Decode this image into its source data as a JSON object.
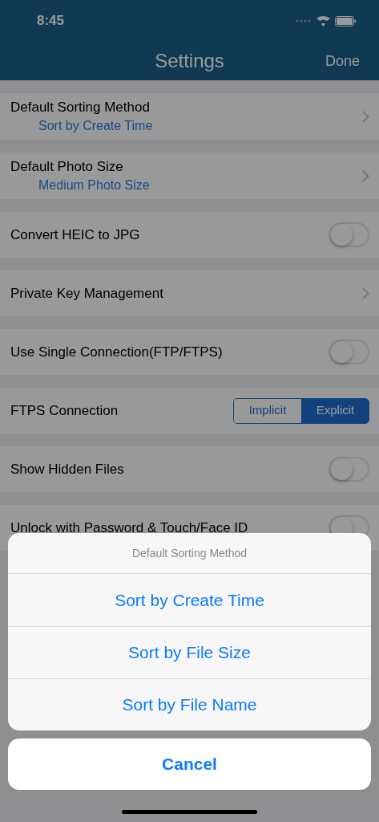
{
  "status_bar": {
    "time": "8:45"
  },
  "nav": {
    "title": "Settings",
    "done": "Done"
  },
  "settings": [
    {
      "kind": "link",
      "label": "Default Sorting Method",
      "value": "Sort by Create Time"
    },
    {
      "kind": "link",
      "label": "Default Photo Size",
      "value": "Medium Photo Size"
    },
    {
      "kind": "toggle",
      "label": "Convert HEIC to JPG",
      "on": false
    },
    {
      "kind": "link",
      "label": "Private Key Management"
    },
    {
      "kind": "toggle",
      "label": "Use Single Connection(FTP/FTPS)",
      "on": false
    },
    {
      "kind": "segmented",
      "label": "FTPS Connection",
      "segments": [
        {
          "label": "Implicit",
          "selected": false
        },
        {
          "label": "Explicit",
          "selected": true
        }
      ]
    },
    {
      "kind": "toggle",
      "label": "Show Hidden Files",
      "on": false
    },
    {
      "kind": "toggle",
      "label": "Unlock with Password & Touch/Face ID",
      "on": false
    }
  ],
  "action_sheet": {
    "title": "Default Sorting Method",
    "options": [
      "Sort by Create Time",
      "Sort by File Size",
      "Sort by File Name"
    ],
    "cancel": "Cancel"
  }
}
